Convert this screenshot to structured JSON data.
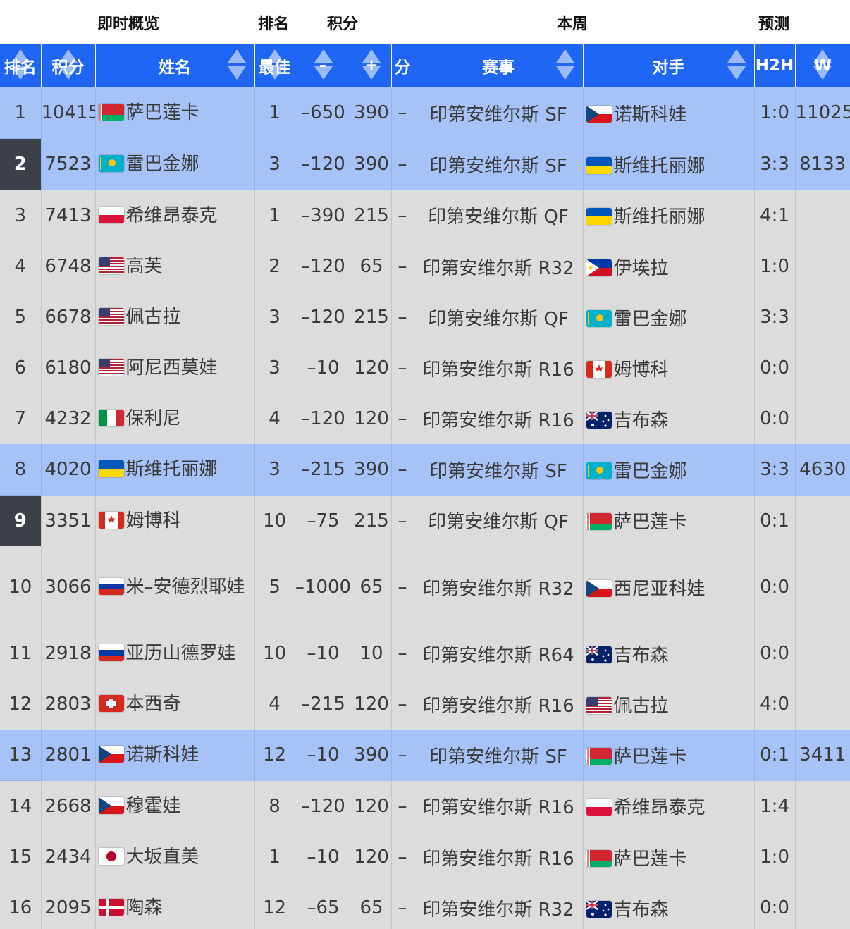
{
  "groups": {
    "live": "即时概览",
    "rank": "排名",
    "points": "积分",
    "week": "本周",
    "predict": "预测"
  },
  "headers": {
    "rank": "排名",
    "points": "积分",
    "name": "姓名",
    "best": "最佳",
    "minus": "–",
    "plus": "+",
    "fen": "分",
    "event": "赛事",
    "opponent": "对手",
    "h2h": "H2H",
    "w": "W"
  },
  "colors": {
    "header_blue": "#1f66f5",
    "row_highlight": "#a6c2f6",
    "row_default": "#dcdcdc",
    "rank_dark": "#3c4049"
  },
  "rows": [
    {
      "rank": "1",
      "points": "10415",
      "flag": "belarus",
      "name": "萨巴莲卡",
      "best": "1",
      "minus": "–650",
      "plus": "390",
      "dash": "–",
      "event": "印第安维尔斯 SF",
      "opp_flag": "czech",
      "opponent": "诺斯科娃",
      "h2h": "1:0",
      "w": "11025",
      "highlight": true,
      "dark_rank": false
    },
    {
      "rank": "2",
      "points": "7523",
      "flag": "kazakhstan",
      "name": "雷巴金娜",
      "best": "3",
      "minus": "–120",
      "plus": "390",
      "dash": "–",
      "event": "印第安维尔斯 SF",
      "opp_flag": "ukraine",
      "opponent": "斯维托丽娜",
      "h2h": "3:3",
      "w": "8133",
      "highlight": true,
      "dark_rank": true
    },
    {
      "rank": "3",
      "points": "7413",
      "flag": "poland",
      "name": "希维昂泰克",
      "best": "1",
      "minus": "–390",
      "plus": "215",
      "dash": "–",
      "event": "印第安维尔斯 QF",
      "opp_flag": "ukraine",
      "opponent": "斯维托丽娜",
      "h2h": "4:1",
      "w": "",
      "highlight": false,
      "dark_rank": false
    },
    {
      "rank": "4",
      "points": "6748",
      "flag": "usa",
      "name": "高芙",
      "best": "2",
      "minus": "–120",
      "plus": "65",
      "dash": "–",
      "event": "印第安维尔斯 R32",
      "opp_flag": "philippines",
      "opponent": "伊埃拉",
      "h2h": "1:0",
      "w": "",
      "highlight": false,
      "dark_rank": false
    },
    {
      "rank": "5",
      "points": "6678",
      "flag": "usa",
      "name": "佩古拉",
      "best": "3",
      "minus": "–120",
      "plus": "215",
      "dash": "–",
      "event": "印第安维尔斯 QF",
      "opp_flag": "kazakhstan",
      "opponent": "雷巴金娜",
      "h2h": "3:3",
      "w": "",
      "highlight": false,
      "dark_rank": false
    },
    {
      "rank": "6",
      "points": "6180",
      "flag": "usa",
      "name": "阿尼西莫娃",
      "best": "3",
      "minus": "–10",
      "plus": "120",
      "dash": "–",
      "event": "印第安维尔斯 R16",
      "opp_flag": "canada",
      "opponent": "姆博科",
      "h2h": "0:0",
      "w": "",
      "highlight": false,
      "dark_rank": false
    },
    {
      "rank": "7",
      "points": "4232",
      "flag": "italy",
      "name": "保利尼",
      "best": "4",
      "minus": "–120",
      "plus": "120",
      "dash": "–",
      "event": "印第安维尔斯 R16",
      "opp_flag": "australia",
      "opponent": "吉布森",
      "h2h": "0:0",
      "w": "",
      "highlight": false,
      "dark_rank": false
    },
    {
      "rank": "8",
      "points": "4020",
      "flag": "ukraine",
      "name": "斯维托丽娜",
      "best": "3",
      "minus": "–215",
      "plus": "390",
      "dash": "–",
      "event": "印第安维尔斯 SF",
      "opp_flag": "kazakhstan",
      "opponent": "雷巴金娜",
      "h2h": "3:3",
      "w": "4630",
      "highlight": true,
      "dark_rank": false
    },
    {
      "rank": "9",
      "points": "3351",
      "flag": "canada",
      "name": "姆博科",
      "best": "10",
      "minus": "–75",
      "plus": "215",
      "dash": "–",
      "event": "印第安维尔斯 QF",
      "opp_flag": "belarus",
      "opponent": "萨巴莲卡",
      "h2h": "0:1",
      "w": "",
      "highlight": false,
      "dark_rank": true
    },
    {
      "rank": "10",
      "points": "3066",
      "flag": "russia",
      "name": "米–安德烈耶娃",
      "best": "5",
      "minus": "–1000",
      "plus": "65",
      "dash": "–",
      "event": "印第安维尔斯 R32",
      "opp_flag": "czech",
      "opponent": "西尼亚科娃",
      "h2h": "0:0",
      "w": "",
      "highlight": false,
      "dark_rank": false,
      "tall": true
    },
    {
      "rank": "11",
      "points": "2918",
      "flag": "russia",
      "name": "亚历山德罗娃",
      "best": "10",
      "minus": "–10",
      "plus": "10",
      "dash": "–",
      "event": "印第安维尔斯 R64",
      "opp_flag": "australia",
      "opponent": "吉布森",
      "h2h": "0:0",
      "w": "",
      "highlight": false,
      "dark_rank": false
    },
    {
      "rank": "12",
      "points": "2803",
      "flag": "switzerland",
      "name": "本西奇",
      "best": "4",
      "minus": "–215",
      "plus": "120",
      "dash": "–",
      "event": "印第安维尔斯 R16",
      "opp_flag": "usa",
      "opponent": "佩古拉",
      "h2h": "4:0",
      "w": "",
      "highlight": false,
      "dark_rank": false
    },
    {
      "rank": "13",
      "points": "2801",
      "flag": "czech",
      "name": "诺斯科娃",
      "best": "12",
      "minus": "–10",
      "plus": "390",
      "dash": "–",
      "event": "印第安维尔斯 SF",
      "opp_flag": "belarus",
      "opponent": "萨巴莲卡",
      "h2h": "0:1",
      "w": "3411",
      "highlight": true,
      "dark_rank": false
    },
    {
      "rank": "14",
      "points": "2668",
      "flag": "czech",
      "name": "穆霍娃",
      "best": "8",
      "minus": "–120",
      "plus": "120",
      "dash": "–",
      "event": "印第安维尔斯 R16",
      "opp_flag": "poland",
      "opponent": "希维昂泰克",
      "h2h": "1:4",
      "w": "",
      "highlight": false,
      "dark_rank": false
    },
    {
      "rank": "15",
      "points": "2434",
      "flag": "japan",
      "name": "大坂直美",
      "best": "1",
      "minus": "–10",
      "plus": "120",
      "dash": "–",
      "event": "印第安维尔斯 R16",
      "opp_flag": "belarus",
      "opponent": "萨巴莲卡",
      "h2h": "1:0",
      "w": "",
      "highlight": false,
      "dark_rank": false
    },
    {
      "rank": "16",
      "points": "2095",
      "flag": "denmark",
      "name": "陶森",
      "best": "12",
      "minus": "–65",
      "plus": "65",
      "dash": "–",
      "event": "印第安维尔斯 R32",
      "opp_flag": "australia",
      "opponent": "吉布森",
      "h2h": "0:0",
      "w": "",
      "highlight": false,
      "dark_rank": false
    }
  ]
}
